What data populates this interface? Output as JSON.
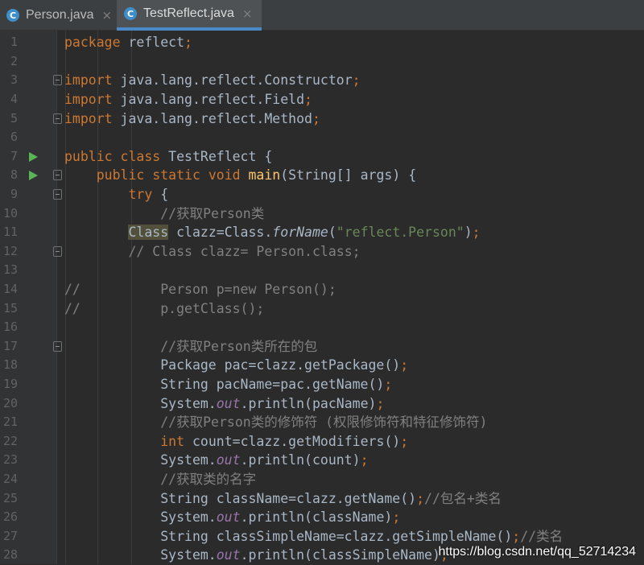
{
  "tabs": [
    {
      "label": "Person.java",
      "icon": "java-class-icon",
      "close_glyph": "×",
      "active": false
    },
    {
      "label": "TestReflect.java",
      "icon": "java-class-icon",
      "close_glyph": "×",
      "active": true
    }
  ],
  "gutter": {
    "run_marker_lines": [
      7,
      8
    ],
    "fold_marker_lines": [
      3,
      5,
      8,
      9,
      12,
      17
    ]
  },
  "lines": [
    {
      "number": "1",
      "tokens": [
        {
          "t": "package",
          "c": "kw"
        },
        {
          "t": " reflect"
        },
        {
          "t": ";",
          "c": "kw"
        }
      ]
    },
    {
      "number": "2",
      "tokens": []
    },
    {
      "number": "3",
      "tokens": [
        {
          "t": "import",
          "c": "kw"
        },
        {
          "t": " java.lang.reflect.Constructor"
        },
        {
          "t": ";",
          "c": "kw"
        }
      ]
    },
    {
      "number": "4",
      "tokens": [
        {
          "t": "import",
          "c": "kw"
        },
        {
          "t": " java.lang.reflect.Field"
        },
        {
          "t": ";",
          "c": "kw"
        }
      ]
    },
    {
      "number": "5",
      "tokens": [
        {
          "t": "import",
          "c": "kw"
        },
        {
          "t": " java.lang.reflect.Method"
        },
        {
          "t": ";",
          "c": "kw"
        }
      ]
    },
    {
      "number": "6",
      "tokens": []
    },
    {
      "number": "7",
      "tokens": [
        {
          "t": "public class",
          "c": "kw"
        },
        {
          "t": " TestReflect {"
        }
      ]
    },
    {
      "number": "8",
      "tokens": [
        {
          "t": "    "
        },
        {
          "t": "public static void",
          "c": "kw"
        },
        {
          "t": " "
        },
        {
          "t": "main",
          "c": "fn"
        },
        {
          "t": "(String[] args) {"
        }
      ]
    },
    {
      "number": "9",
      "tokens": [
        {
          "t": "        "
        },
        {
          "t": "try",
          "c": "kw"
        },
        {
          "t": " {"
        }
      ]
    },
    {
      "number": "10",
      "tokens": [
        {
          "t": "            "
        },
        {
          "t": "//获取Person类",
          "c": "cm"
        }
      ]
    },
    {
      "number": "11",
      "tokens": [
        {
          "t": "        "
        },
        {
          "t": "Class",
          "c": "hl"
        },
        {
          "t": " clazz=Class."
        },
        {
          "t": "forName",
          "c": "fi"
        },
        {
          "t": "("
        },
        {
          "t": "\"reflect.Person\"",
          "c": "str"
        },
        {
          "t": ")"
        },
        {
          "t": ";",
          "c": "kw"
        }
      ]
    },
    {
      "number": "12",
      "tokens": [
        {
          "t": "        "
        },
        {
          "t": "// Class clazz= Person.class;",
          "c": "cm"
        }
      ]
    },
    {
      "number": "13",
      "tokens": []
    },
    {
      "number": "14",
      "tokens": [
        {
          "t": "//          Person p=new Person();",
          "c": "cm"
        }
      ]
    },
    {
      "number": "15",
      "tokens": [
        {
          "t": "//          p.getClass();",
          "c": "cm"
        }
      ]
    },
    {
      "number": "16",
      "tokens": []
    },
    {
      "number": "17",
      "tokens": [
        {
          "t": "            "
        },
        {
          "t": "//获取Person类所在的包",
          "c": "cm"
        }
      ]
    },
    {
      "number": "18",
      "tokens": [
        {
          "t": "            Package pac=clazz.getPackage()"
        },
        {
          "t": ";",
          "c": "kw"
        }
      ]
    },
    {
      "number": "19",
      "tokens": [
        {
          "t": "            String pacName=pac.getName()"
        },
        {
          "t": ";",
          "c": "kw"
        }
      ]
    },
    {
      "number": "20",
      "tokens": [
        {
          "t": "            System."
        },
        {
          "t": "out",
          "c": "st"
        },
        {
          "t": ".println(pacName)"
        },
        {
          "t": ";",
          "c": "kw"
        }
      ]
    },
    {
      "number": "21",
      "tokens": [
        {
          "t": "            "
        },
        {
          "t": "//获取Person类的修饰符 (权限修饰符和特征修饰符)",
          "c": "cm"
        }
      ]
    },
    {
      "number": "22",
      "tokens": [
        {
          "t": "            "
        },
        {
          "t": "int",
          "c": "kw"
        },
        {
          "t": " count=clazz.getModifiers()"
        },
        {
          "t": ";",
          "c": "kw"
        }
      ]
    },
    {
      "number": "23",
      "tokens": [
        {
          "t": "            System."
        },
        {
          "t": "out",
          "c": "st"
        },
        {
          "t": ".println(count)"
        },
        {
          "t": ";",
          "c": "kw"
        }
      ]
    },
    {
      "number": "24",
      "tokens": [
        {
          "t": "            "
        },
        {
          "t": "//获取类的名字",
          "c": "cm"
        }
      ]
    },
    {
      "number": "25",
      "tokens": [
        {
          "t": "            String className=clazz.getName()"
        },
        {
          "t": ";",
          "c": "kw"
        },
        {
          "t": "//包名+类名",
          "c": "cm"
        }
      ]
    },
    {
      "number": "26",
      "tokens": [
        {
          "t": "            System."
        },
        {
          "t": "out",
          "c": "st"
        },
        {
          "t": ".println(className)"
        },
        {
          "t": ";",
          "c": "kw"
        }
      ]
    },
    {
      "number": "27",
      "tokens": [
        {
          "t": "            String classSimpleName=clazz.getSimpleName()"
        },
        {
          "t": ";",
          "c": "kw"
        },
        {
          "t": "//类名",
          "c": "cm"
        }
      ]
    },
    {
      "number": "28",
      "tokens": [
        {
          "t": "            System."
        },
        {
          "t": "out",
          "c": "st"
        },
        {
          "t": ".println(classSimpleName)"
        },
        {
          "t": ";",
          "c": "kw"
        }
      ]
    }
  ],
  "watermark": "https://blog.csdn.net/qq_52714234",
  "colors": {
    "background": "#2b2b2b",
    "gutter": "#313335",
    "keyword": "#cc7832",
    "method": "#ffc66d",
    "string": "#6a8759",
    "comment": "#808080",
    "static_field": "#9876aa",
    "default_text": "#a9b7c6",
    "line_number": "#606366",
    "run_marker": "#5ab557",
    "active_tab_underline": "#4a88c7"
  }
}
